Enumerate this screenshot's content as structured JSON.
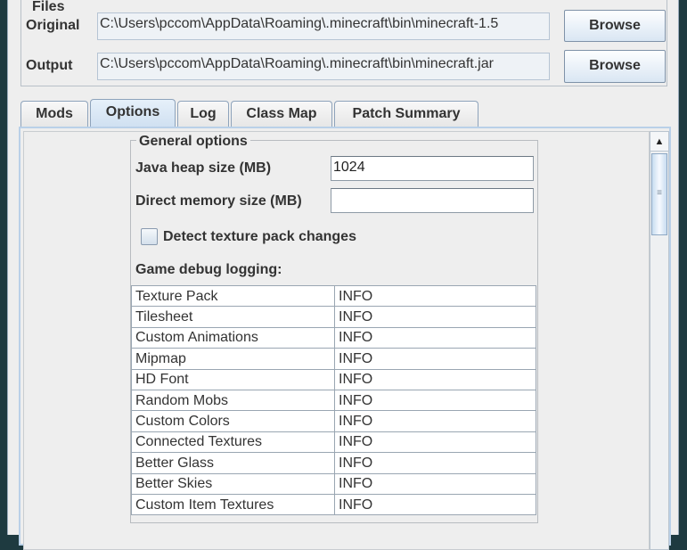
{
  "files": {
    "title": "Files",
    "original": {
      "label": "Original",
      "value": "C:\\Users\\pccom\\AppData\\Roaming\\.minecraft\\bin\\minecraft-1.5",
      "browse": "Browse"
    },
    "output": {
      "label": "Output",
      "value": "C:\\Users\\pccom\\AppData\\Roaming\\.minecraft\\bin\\minecraft.jar",
      "browse": "Browse"
    }
  },
  "tabs": [
    {
      "label": "Mods"
    },
    {
      "label": "Options",
      "selected": true
    },
    {
      "label": "Log"
    },
    {
      "label": "Class Map"
    },
    {
      "label": "Patch Summary"
    }
  ],
  "options": {
    "group_title": "General options",
    "heap_label": "Java heap size (MB)",
    "heap_value": "1024",
    "direct_label": "Direct memory size (MB)",
    "direct_value": "",
    "detect_label": "Detect texture pack changes",
    "detect_checked": false,
    "debug_label": "Game debug logging:",
    "debug_rows": [
      [
        "Texture Pack",
        "INFO"
      ],
      [
        "Tilesheet",
        "INFO"
      ],
      [
        "Custom Animations",
        "INFO"
      ],
      [
        "Mipmap",
        "INFO"
      ],
      [
        "HD Font",
        "INFO"
      ],
      [
        "Random Mobs",
        "INFO"
      ],
      [
        "Custom Colors",
        "INFO"
      ],
      [
        "Connected Textures",
        "INFO"
      ],
      [
        "Better Glass",
        "INFO"
      ],
      [
        "Better Skies",
        "INFO"
      ],
      [
        "Custom Item Textures",
        "INFO"
      ]
    ]
  }
}
